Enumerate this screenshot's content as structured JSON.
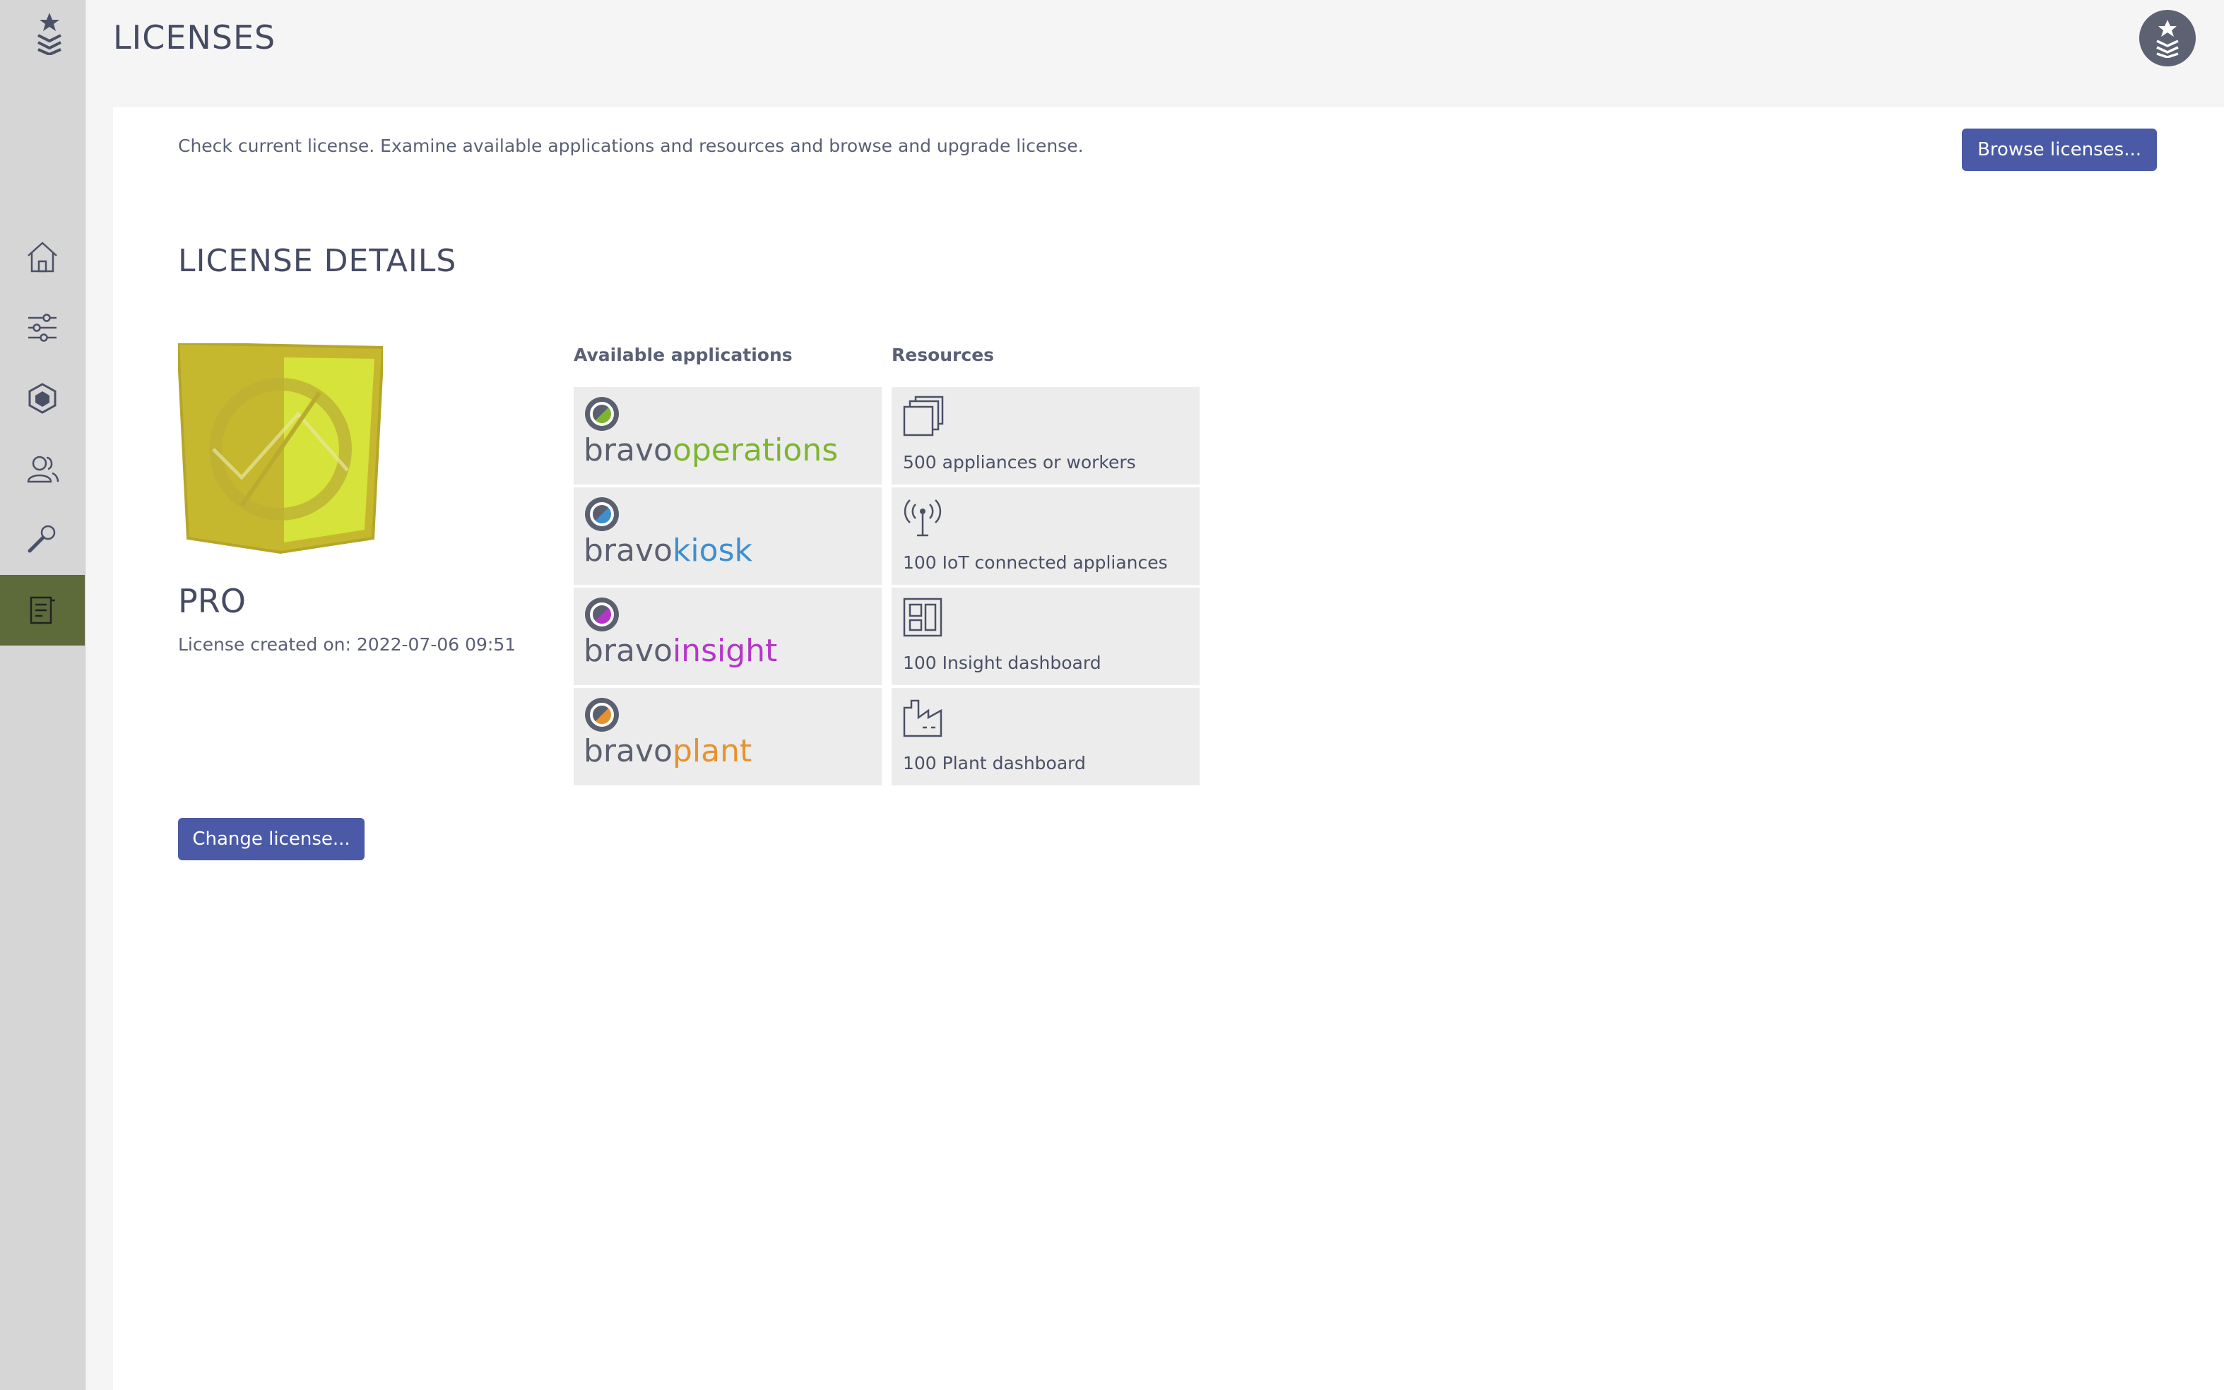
{
  "app": {
    "title": "LICENSES"
  },
  "colors": {
    "accent_button": "#4a5aa6",
    "active_nav": "#5d6b3a",
    "badge_gold": "#c6b82e",
    "operations": "#7db52f",
    "kiosk": "#3d8fcf",
    "insight": "#b535c9",
    "plant": "#e6922f"
  },
  "sidebar": {
    "items": [
      {
        "name": "home",
        "icon": "home-icon"
      },
      {
        "name": "settings",
        "icon": "sliders-icon"
      },
      {
        "name": "appliances",
        "icon": "cube-icon"
      },
      {
        "name": "users",
        "icon": "users-icon"
      },
      {
        "name": "tools",
        "icon": "wrench-icon"
      },
      {
        "name": "licenses",
        "icon": "document-icon",
        "active": true
      }
    ]
  },
  "header": {
    "description": "Check current license. Examine available applications and resources and browse and upgrade license.",
    "browse_label": "Browse licenses..."
  },
  "license": {
    "section_title": "LICENSE DETAILS",
    "plan": "PRO",
    "created_on": "License created on: 2022-07-06 09:51",
    "change_label": "Change license..."
  },
  "applications": {
    "header": "Available applications",
    "items": [
      {
        "brand": "bravo",
        "name": "operations"
      },
      {
        "brand": "bravo",
        "name": "kiosk"
      },
      {
        "brand": "bravo",
        "name": "insight"
      },
      {
        "brand": "bravo",
        "name": "plant"
      }
    ]
  },
  "resources": {
    "header": "Resources",
    "items": [
      {
        "label": "500 appliances or workers",
        "icon": "stack-icon"
      },
      {
        "label": "100 IoT connected appliances",
        "icon": "antenna-icon"
      },
      {
        "label": "100 Insight dashboard",
        "icon": "dashboard-icon"
      },
      {
        "label": "100 Plant dashboard",
        "icon": "factory-icon"
      }
    ]
  }
}
